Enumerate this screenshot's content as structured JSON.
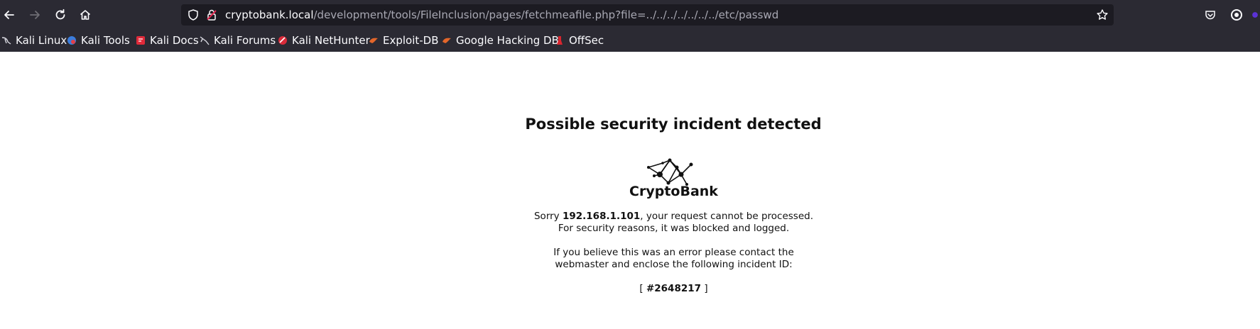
{
  "browser": {
    "url_host": "cryptobank.local",
    "url_path": "/development/tools/FileInclusion/pages/fetchmeafile.php?file=../../../../../../../etc/passwd",
    "bookmarks": [
      {
        "label": "Kali Linux",
        "icon": "kali-dragon-icon"
      },
      {
        "label": "Kali Tools",
        "icon": "kali-tools-icon"
      },
      {
        "label": "Kali Docs",
        "icon": "kali-docs-icon"
      },
      {
        "label": "Kali Forums",
        "icon": "kali-forums-icon"
      },
      {
        "label": "Kali NetHunter",
        "icon": "kali-nethunter-icon"
      },
      {
        "label": "Exploit-DB",
        "icon": "exploit-db-icon"
      },
      {
        "label": "Google Hacking DB",
        "icon": "ghdb-icon"
      },
      {
        "label": "OffSec",
        "icon": "offsec-icon"
      }
    ]
  },
  "page": {
    "headline": "Possible security incident detected",
    "brand": "CryptoBank",
    "sorry_prefix": "Sorry ",
    "client_ip": "192.168.1.101",
    "sorry_suffix": ", your request cannot be processed.",
    "blocked_line": "For security reasons, it was blocked and logged.",
    "error_line1": "If you believe this was an error please contact the",
    "error_line2": "webmaster and enclose the following incident ID:",
    "incident_open": "[ ",
    "incident_id": "#2648217",
    "incident_close": " ]"
  },
  "colors": {
    "chrome_bg": "#2b2a33",
    "urlbar_bg": "#1c1b22",
    "text_light": "#fbfbfe",
    "url_path": "#a8a8b3"
  }
}
